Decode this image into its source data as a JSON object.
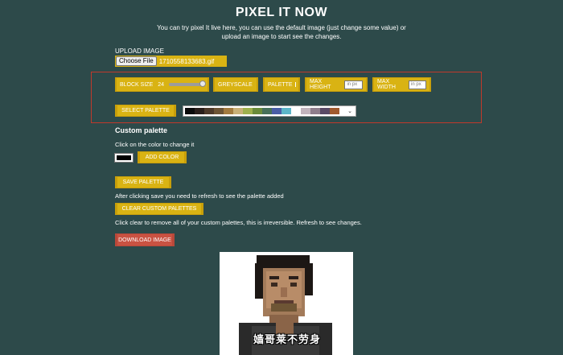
{
  "header": {
    "title": "PIXEL IT NOW",
    "intro_line1": "You can try pixel It live here, you can use the default image (just change some value) or",
    "intro_line2": "upload an image to start see the changes."
  },
  "upload": {
    "label": "UPLOAD IMAGE",
    "choose_file_label": "Choose File",
    "file_name": "1710558133683.gif"
  },
  "settings": {
    "block_size_label": "BLOCK SIZE",
    "block_size_value": "24",
    "block_size_fraction": 1.0,
    "greyscale_label": "GREYSCALE",
    "palette_label": "PALETTE",
    "max_height_label": "MAX HEIGHT",
    "max_height_placeholder": "in px",
    "max_width_label": "MAX WIDTH",
    "max_width_placeholder": "in px",
    "select_palette_label": "SELECT PALETTE",
    "palette_colors": [
      "#0b0b0b",
      "#2a1f1b",
      "#4e3a2a",
      "#6e5535",
      "#a37b3f",
      "#c9b077",
      "#9fb04d",
      "#6b8b3a",
      "#48705a",
      "#4a5da6",
      "#5cb5c8",
      "#ffffff",
      "#c2b4bd",
      "#8f7e8c",
      "#5a4a66",
      "#a15a2e"
    ]
  },
  "custom_palette": {
    "heading": "Custom palette",
    "instructions": "Click on the color to change it",
    "current_color": "#000000",
    "add_color_label": "ADD COLOR",
    "save_palette_label": "SAVE PALETTE",
    "save_note": "After clicking save you need to refresh to see the palette added",
    "clear_label": "CLEAR CUSTOM PALETTES",
    "clear_note": "Click clear to remove all of your custom palettes, this is irreversible. Refresh to see changes."
  },
  "download": {
    "label": "DOWNLOAD IMAGE"
  },
  "preview": {
    "caption_glyphs": "嫱哥莱不劳身"
  },
  "colors": {
    "background": "#2d4a4a",
    "button": "#d9b313",
    "download_button": "#c95242",
    "frame_border": "#c0392b"
  }
}
